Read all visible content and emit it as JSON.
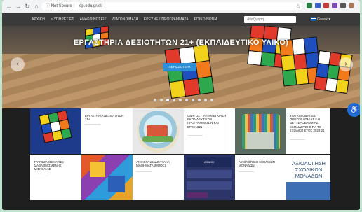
{
  "browser": {
    "security_label": "Not Secure",
    "url": "iep.edu.gr/el/"
  },
  "nav": {
    "items": [
      "ΑΡΧΙΚΗ",
      "e-ΥΠΗΡΕΣΙΕΣ",
      "ΑΝΑΚΟΙΝΩΣΕΙΣ",
      "ΔΙΑΓΩΝΙΣΜΑΤΑ",
      "ΕΡΕΥΝΕΣ/ΠΡΟΓΡΑΜΜΑΤΑ",
      "ΕΠΙΚΟΙΝΩΝΙΑ"
    ],
    "search_placeholder": "Αναζήτηση...",
    "language": "Greek"
  },
  "hero": {
    "title": "ΕΡΓΑΣΤΗΡΙΑ ΔΕΞΙΟΤΗΤΩΝ 21+ (ΕΚΠΑΙΔΕΥΤΙΚΟ ΥΛΙΚΟ)",
    "button_label": "ΠΕΡΙΣΣΟΤΕΡΑ",
    "slide_count": 10,
    "active_slide": 2
  },
  "tiles": {
    "row1": [
      "ΕΡΓΑΣΤΗΡΙΑ ΔΕΞΙΟΤΗΤΩΝ 21+",
      "ΟΔΗΓΟΣ ΓΙΑ ΤΗΝ ΕΓΚΡΙΣΗ ΕΚΠΑΙΔΕΥΤΙΚΩΝ ΠΡΟΓΡΑΜΜΑΤΩΝ ΚΑΙ ΕΡΕΥΝΩΝ",
      "ΥΛΗ ΚΑΙ ΟΔΗΓΙΕΣ ΠΡΩΤΟΒΑΘΜΙΑΣ ΚΑΙ ΔΕΥΤΕΡΟΒΑΘΜΙΑΣ ΕΚΠΑΙΔΕΥΣΗΣ ΓΙΑ ΤΟ ΣΧΟΛΙΚΟ ΕΤΟΣ 2020-21"
    ],
    "row2": [
      "ΤΡΑΠΕΖΑ ΘΕΜΑΤΩΝ ΔΙΑΒΑΘΜΙΣΜΕΝΗΣ ΔΥΣΚΟΛΙΑΣ",
      "ΑΝΟΙΚΤΑ ΔΙΑΔΙΚΤΥΑΚΑ ΜΑΘΗΜΑΤΑ (MOOC)",
      "ΑΞΙΟΛΟΓΗΣΗ ΣΧΟΛΙΚΩΝ ΜΟΝΑΔΩΝ"
    ],
    "poster_title": "ΑΞΙΟΛΟΓΗΣΗ ΣΧΟΛΙΚΩΝ ΜΟΝΑΔΩΝ"
  },
  "colors": {
    "accent": "#2e8fd6",
    "accessibility": "#1d6fd6",
    "nav_bg": "#3a3a3a"
  }
}
